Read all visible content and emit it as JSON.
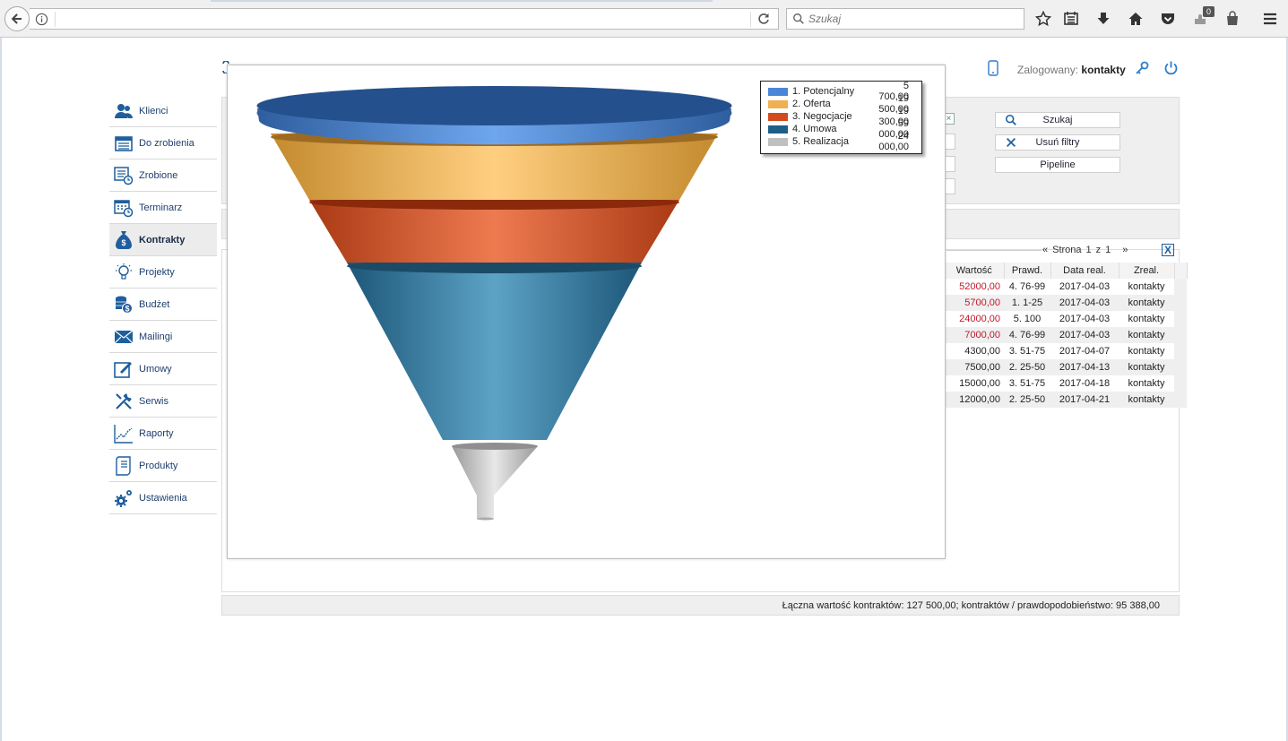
{
  "browser": {
    "search_placeholder": "Szukaj",
    "badge_count": "0"
  },
  "header": {
    "logged_label": "Zalogowany:",
    "logged_user": "kontakty"
  },
  "sidebar": {
    "items": [
      {
        "label": "Klienci",
        "icon": "clients-icon"
      },
      {
        "label": "Do zrobienia",
        "icon": "todo-icon"
      },
      {
        "label": "Zrobione",
        "icon": "done-icon"
      },
      {
        "label": "Terminarz",
        "icon": "calendar-icon"
      },
      {
        "label": "Kontrakty",
        "icon": "money-bag-icon",
        "active": true
      },
      {
        "label": "Projekty",
        "icon": "lightbulb-icon"
      },
      {
        "label": "Budżet",
        "icon": "coins-icon"
      },
      {
        "label": "Mailingi",
        "icon": "envelope-icon"
      },
      {
        "label": "Umowy",
        "icon": "pen-edit-icon"
      },
      {
        "label": "Serwis",
        "icon": "tools-icon"
      },
      {
        "label": "Raporty",
        "icon": "chart-line-icon"
      },
      {
        "label": "Produkty",
        "icon": "document-icon"
      },
      {
        "label": "Ustawienia",
        "icon": "gears-icon"
      }
    ]
  },
  "filters": {
    "search_button": "Szukaj",
    "clear_button": "Usuń filtry",
    "pipeline_button": "Pipeline"
  },
  "pager": {
    "prev": "«",
    "label": "Strona",
    "current": "1",
    "of": "z",
    "total": "1",
    "next": "»"
  },
  "table": {
    "columns": [
      "Wartość",
      "Prawd.",
      "Data real.",
      "Zreal."
    ],
    "rows": [
      {
        "value": "52000,00",
        "prob": "4. 76-99",
        "date": "2017-04-03",
        "user": "kontakty",
        "red": true
      },
      {
        "value": "5700,00",
        "prob": "1. 1-25",
        "date": "2017-04-03",
        "user": "kontakty",
        "red": true
      },
      {
        "value": "24000,00",
        "prob": "5. 100",
        "date": "2017-04-03",
        "user": "kontakty",
        "red": true
      },
      {
        "value": "7000,00",
        "prob": "4. 76-99",
        "date": "2017-04-03",
        "user": "kontakty",
        "red": true
      },
      {
        "value": "4300,00",
        "prob": "3. 51-75",
        "date": "2017-04-07",
        "user": "kontakty",
        "red": false
      },
      {
        "value": "7500,00",
        "prob": "2. 25-50",
        "date": "2017-04-13",
        "user": "kontakty",
        "red": false
      },
      {
        "value": "15000,00",
        "prob": "3. 51-75",
        "date": "2017-04-18",
        "user": "kontakty",
        "red": false
      },
      {
        "value": "12000,00",
        "prob": "2. 25-50",
        "date": "2017-04-21",
        "user": "kontakty",
        "red": false
      }
    ]
  },
  "footer": {
    "summary": "Łączna wartość kontraktów: 127 500,00; kontraktów / prawdopodobieństwo: 95 388,00"
  },
  "chart_data": {
    "type": "funnel",
    "legend_position": "top-right",
    "series": [
      {
        "name": "1. Potencjalny",
        "value": 5700,
        "label": "5 700,00",
        "color": "#4a86d8"
      },
      {
        "name": "2. Oferta",
        "value": 19500,
        "label": "19 500,00",
        "color": "#f0b050"
      },
      {
        "name": "3. Negocjacje",
        "value": 19300,
        "label": "19 300,00",
        "color": "#d34a1e"
      },
      {
        "name": "4. Umowa",
        "value": 59000,
        "label": "59 000,00",
        "color": "#1e5f86"
      },
      {
        "name": "5. Realizacja",
        "value": 24000,
        "label": "24 000,00",
        "color": "#c0c0c0"
      }
    ]
  }
}
